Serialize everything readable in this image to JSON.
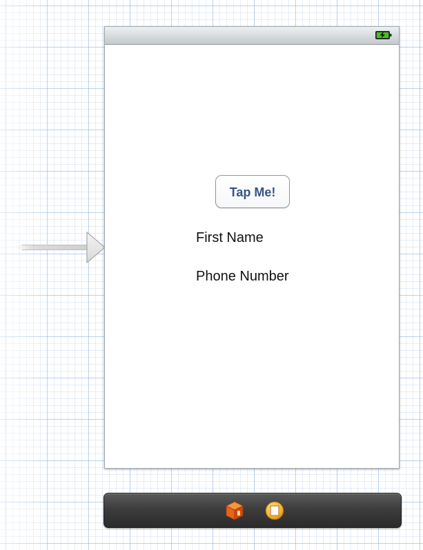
{
  "scene": {
    "status_bar": {
      "battery_icon": "battery-charging-icon"
    },
    "button": {
      "label": "Tap Me!"
    },
    "labels": {
      "first_name": "First Name",
      "phone_number": "Phone Number"
    }
  },
  "dock": {
    "items": [
      {
        "icon": "first-responder-cube-icon"
      },
      {
        "icon": "view-controller-icon"
      }
    ]
  },
  "colors": {
    "button_text": "#385487",
    "grid_line": "#96b9e1",
    "dock_background": "#3d3d3d",
    "cube_orange": "#e8631b",
    "vc_yellow": "#f3b22b"
  }
}
